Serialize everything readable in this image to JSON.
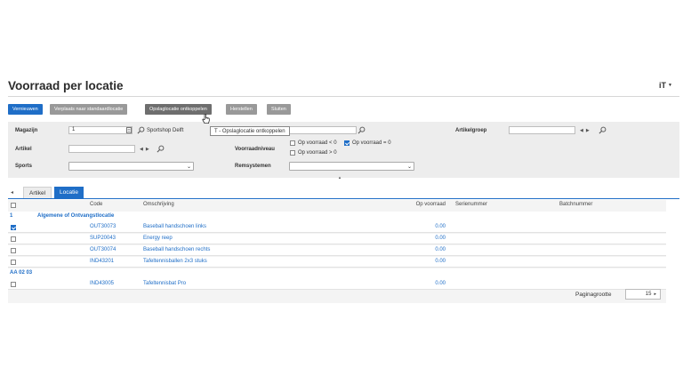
{
  "page": {
    "title": "Voorraad per locatie",
    "menu_label": "iT"
  },
  "toolbar": {
    "buttons": [
      {
        "label": "Vernieuwen"
      },
      {
        "label": "Verplaats naar standaardlocatie"
      },
      {
        "label": "Opslaglocatie ontkoppelen"
      },
      {
        "label": "Herstellen"
      },
      {
        "label": "Sluiten"
      }
    ],
    "tooltip": "T - Opslaglocatie ontkoppelen"
  },
  "filters": {
    "magazijn": {
      "label": "Magazijn",
      "value": "1",
      "link": "Sportshop Delft"
    },
    "artikel": {
      "label": "Artikel",
      "value": ""
    },
    "sports": {
      "label": "Sports",
      "value": ""
    },
    "voorraadniveau": {
      "label": "Voorraadniveau",
      "options": [
        {
          "label": "Op voorraad < 0",
          "checked": false
        },
        {
          "label": "Op voorraad = 0",
          "checked": true
        },
        {
          "label": "Op voorraad > 0",
          "checked": false
        }
      ]
    },
    "remsystemen": {
      "label": "Remsystemen",
      "value": ""
    },
    "artikelgroep": {
      "label": "Artikelgroep",
      "value": ""
    }
  },
  "tabs": [
    {
      "label": "Artikel",
      "active": false
    },
    {
      "label": "Locatie",
      "active": true
    }
  ],
  "grid": {
    "columns": {
      "code": "Code",
      "omschrijving": "Omschrijving",
      "op_voorraad": "Op voorraad",
      "serienummer": "Serienummer",
      "batchnummer": "Batchnummer"
    },
    "groups": [
      {
        "key": "1",
        "name": "Algemene of Ontvangstlocatie",
        "rows": [
          {
            "checked": true,
            "code": "OUT30073",
            "omschrijving": "Baseball handschoen links",
            "op_voorraad": "0.00"
          },
          {
            "checked": false,
            "code": "SUP20043",
            "omschrijving": "Energy reep",
            "op_voorraad": "0.00"
          },
          {
            "checked": false,
            "code": "OUT30074",
            "omschrijving": "Baseball handschoen rechts",
            "op_voorraad": "0.00"
          },
          {
            "checked": false,
            "code": "IND43201",
            "omschrijving": "Tafeltennisballen 2x3 stuks",
            "op_voorraad": "0.00"
          }
        ]
      },
      {
        "key": "AA 02 03",
        "name": "",
        "rows": [
          {
            "checked": false,
            "code": "IND43005",
            "omschrijving": "Tafeltennisbat Pro",
            "op_voorraad": "0.00"
          }
        ]
      }
    ]
  },
  "pager": {
    "label": "Paginagrootte",
    "value": "15"
  },
  "colors": {
    "accent": "#1f6ec7",
    "button_gray": "#999999",
    "button_dark": "#6e6e6e",
    "panel": "#ededed"
  }
}
